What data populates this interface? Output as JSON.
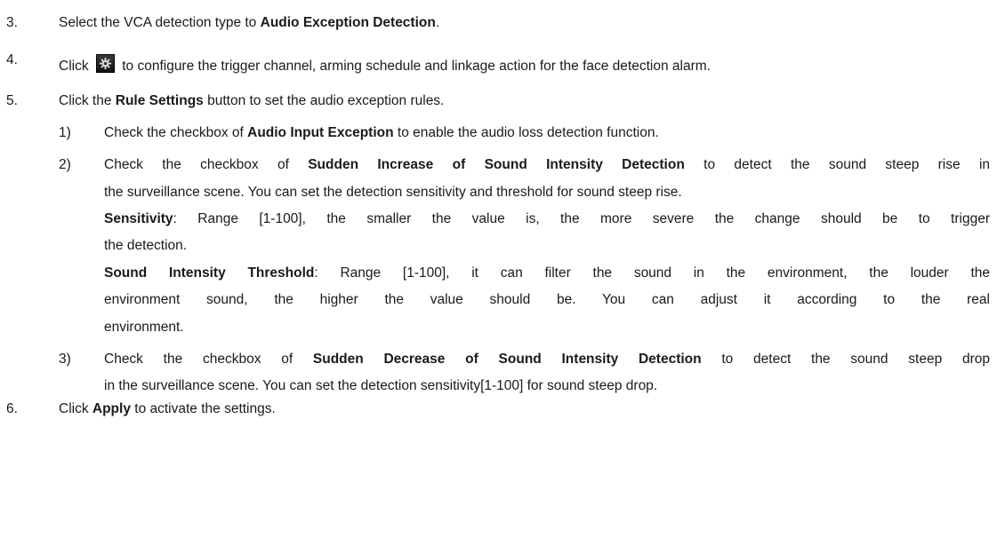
{
  "steps": {
    "s3": {
      "num": "3.",
      "pre": "Select the VCA detection type to ",
      "bold": "Audio Exception Detection",
      "post": "."
    },
    "s4": {
      "num": "4.",
      "pre": "Click",
      "post": "to configure the trigger channel, arming schedule and linkage action for the face detection alarm.",
      "icon": "gear-icon"
    },
    "s5": {
      "num": "5.",
      "pre": "Click the ",
      "bold": "Rule Settings",
      "post": " button to set the audio exception rules."
    },
    "s6": {
      "num": "6.",
      "pre": "Click ",
      "bold": "Apply",
      "post": " to activate the settings."
    }
  },
  "sub": {
    "i1": {
      "num": "1)",
      "pre": "Check the checkbox of ",
      "bold": "Audio Input Exception",
      "post": " to enable the audio loss detection function."
    },
    "i2": {
      "num": "2)",
      "l1_pre": "Check the checkbox of ",
      "l1_bold": "Sudden Increase of Sound Intensity Detection",
      "l1_post": " to detect the sound steep rise in",
      "l2": "the surveillance scene. You can set the detection sensitivity and threshold for sound steep rise.",
      "sens_bold": "Sensitivity",
      "sens_l1": ": Range [1-100], the smaller the value is, the more severe the change should be to trigger",
      "sens_l2": "the detection.",
      "thr_bold": "Sound Intensity Threshold",
      "thr_l1": ": Range [1-100], it can filter the sound in the environment, the louder the",
      "thr_l2": "environment sound, the higher the value should be. You can adjust it according to the real",
      "thr_l3": "environment."
    },
    "i3": {
      "num": "3)",
      "l1_pre": "Check the checkbox of ",
      "l1_bold": "Sudden Decrease of Sound Intensity Detection",
      "l1_post": " to detect the sound steep drop",
      "l2": "in the surveillance scene. You can set the detection sensitivity[1-100] for sound steep drop."
    }
  }
}
